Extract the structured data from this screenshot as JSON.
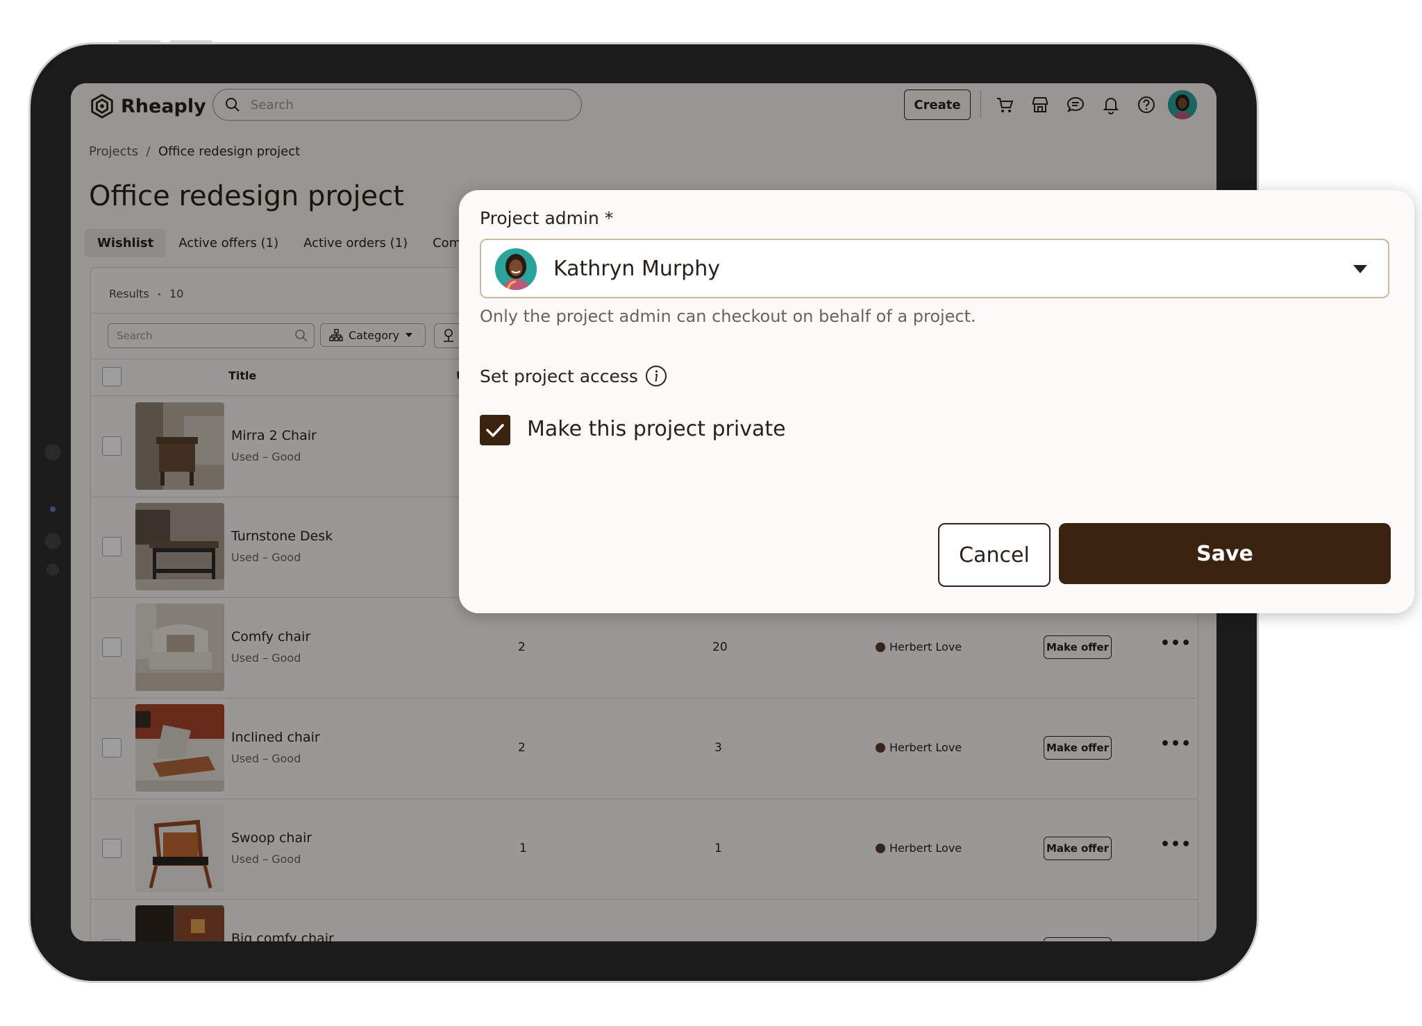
{
  "app": {
    "name": "Rheaply"
  },
  "header": {
    "search_placeholder": "Search",
    "create_label": "Create",
    "icons": [
      "cart-icon",
      "store-icon",
      "chat-icon",
      "bell-icon",
      "help-icon"
    ]
  },
  "breadcrumb": {
    "root": "Projects",
    "separator": "/",
    "current": "Office redesign project"
  },
  "page": {
    "title": "Office redesign project"
  },
  "tabs": [
    {
      "label": "Wishlist",
      "active": true
    },
    {
      "label": "Active offers (1)",
      "active": false
    },
    {
      "label": "Active orders (1)",
      "active": false
    },
    {
      "label": "Comple",
      "active": false
    }
  ],
  "results": {
    "label": "Results",
    "separator": "•",
    "count": "10"
  },
  "filters": {
    "search_placeholder": "Search",
    "category_label": "Category"
  },
  "table": {
    "title_header": "Title",
    "col_fragment": "U",
    "rows": [
      {
        "name": "Mirra 2 Chair",
        "condition": "Used – Good",
        "qty1": "",
        "qty2": "",
        "seller": "",
        "offer": ""
      },
      {
        "name": "Turnstone Desk",
        "condition": "Used – Good",
        "qty1": "",
        "qty2": "",
        "seller": "",
        "offer": ""
      },
      {
        "name": "Comfy chair",
        "condition": "Used – Good",
        "qty1": "2",
        "qty2": "20",
        "seller": "Herbert Love",
        "offer": "Make offer"
      },
      {
        "name": "Inclined chair",
        "condition": "Used – Good",
        "qty1": "2",
        "qty2": "3",
        "seller": "Herbert Love",
        "offer": "Make offer"
      },
      {
        "name": "Swoop chair",
        "condition": "Used – Good",
        "qty1": "1",
        "qty2": "1",
        "seller": "Herbert Love",
        "offer": "Make offer"
      },
      {
        "name": "Big comfy chair",
        "condition": "",
        "qty1": "",
        "qty2": "",
        "seller": "",
        "offer": ""
      }
    ]
  },
  "modal": {
    "admin_label": "Project admin *",
    "admin_value": "Kathryn Murphy",
    "admin_help": "Only the project admin can checkout on behalf of a project.",
    "access_label": "Set project access",
    "private_label": "Make this project private",
    "private_checked": true,
    "cancel_label": "Cancel",
    "save_label": "Save"
  },
  "colors": {
    "brand_dark": "#3a2410",
    "accent_border": "#c8b89a",
    "text": "#2b2118"
  }
}
